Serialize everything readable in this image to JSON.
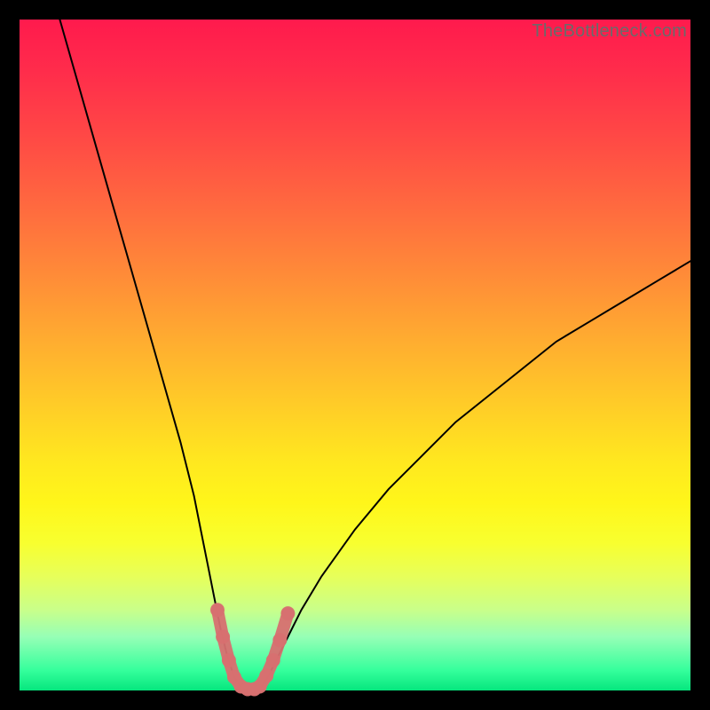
{
  "watermark": "TheBottleneck.com",
  "colors": {
    "frame": "#000000",
    "curve": "#000000",
    "marker": "#d77070",
    "gradient_top": "#ff1a4d",
    "gradient_bottom": "#06e67e"
  },
  "chart_data": {
    "type": "line",
    "title": "",
    "xlabel": "",
    "ylabel": "",
    "xlim": [
      0,
      100
    ],
    "ylim": [
      0,
      100
    ],
    "series": [
      {
        "name": "bottleneck-curve",
        "x": [
          6,
          8,
          10,
          12,
          14,
          16,
          18,
          20,
          22,
          24,
          26,
          27,
          28,
          29,
          30,
          31,
          32,
          33,
          34,
          35,
          36,
          37,
          38,
          40,
          42,
          45,
          50,
          55,
          60,
          65,
          70,
          75,
          80,
          85,
          90,
          95,
          100
        ],
        "y": [
          100,
          93,
          86,
          79,
          72,
          65,
          58,
          51,
          44,
          37,
          29,
          24,
          19,
          14,
          9,
          5,
          2,
          0.5,
          0,
          0,
          0.5,
          2,
          4,
          8,
          12,
          17,
          24,
          30,
          35,
          40,
          44,
          48,
          52,
          55,
          58,
          61,
          64
        ]
      }
    ],
    "markers": {
      "name": "highlighted-range",
      "x": [
        29.5,
        30.3,
        31.2,
        32.0,
        33.0,
        34.0,
        35.0,
        35.8,
        36.8,
        37.8,
        38.8,
        40.0
      ],
      "y": [
        12.0,
        8.0,
        4.5,
        2.0,
        0.6,
        0.2,
        0.2,
        0.6,
        2.2,
        4.5,
        7.5,
        11.5
      ]
    }
  }
}
